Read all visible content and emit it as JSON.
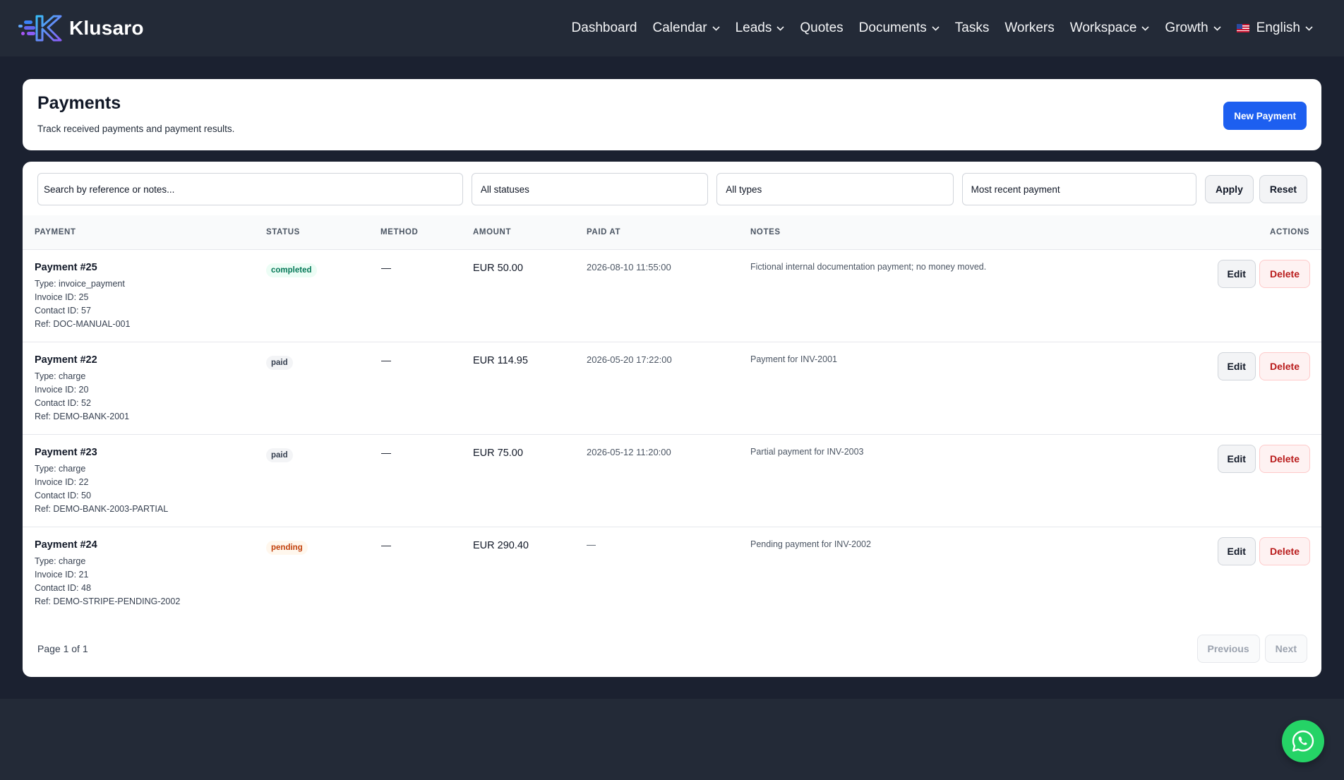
{
  "brand": {
    "name": "Klusaro"
  },
  "nav": {
    "items": [
      {
        "label": "Dashboard",
        "dropdown": false
      },
      {
        "label": "Calendar",
        "dropdown": true
      },
      {
        "label": "Leads",
        "dropdown": true
      },
      {
        "label": "Quotes",
        "dropdown": false
      },
      {
        "label": "Documents",
        "dropdown": true
      },
      {
        "label": "Tasks",
        "dropdown": false
      },
      {
        "label": "Workers",
        "dropdown": false
      },
      {
        "label": "Workspace",
        "dropdown": true
      },
      {
        "label": "Growth",
        "dropdown": true
      }
    ],
    "language": "English"
  },
  "header": {
    "title": "Payments",
    "subtitle": "Track received payments and payment results.",
    "new_button": "New Payment"
  },
  "filters": {
    "search_placeholder": "Search by reference or notes...",
    "status": "All statuses",
    "type": "All types",
    "sort": "Most recent payment",
    "apply": "Apply",
    "reset": "Reset"
  },
  "table": {
    "headers": {
      "payment": "PAYMENT",
      "status": "STATUS",
      "method": "METHOD",
      "amount": "AMOUNT",
      "paid_at": "PAID AT",
      "notes": "NOTES",
      "actions": "ACTIONS"
    },
    "rows": [
      {
        "title": "Payment #25",
        "type": "Type: invoice_payment",
        "invoice": "Invoice ID: 25",
        "contact": "Contact ID: 57",
        "ref": "Ref: DOC-MANUAL-001",
        "status": "completed",
        "method": "—",
        "amount": "EUR 50.00",
        "paid_at": "2026-08-10 11:55:00",
        "notes": "Fictional internal documentation payment; no money moved.",
        "edit": "Edit",
        "delete": "Delete"
      },
      {
        "title": "Payment #22",
        "type": "Type: charge",
        "invoice": "Invoice ID: 20",
        "contact": "Contact ID: 52",
        "ref": "Ref: DEMO-BANK-2001",
        "status": "paid",
        "method": "—",
        "amount": "EUR 114.95",
        "paid_at": "2026-05-20 17:22:00",
        "notes": "Payment for INV-2001",
        "edit": "Edit",
        "delete": "Delete"
      },
      {
        "title": "Payment #23",
        "type": "Type: charge",
        "invoice": "Invoice ID: 22",
        "contact": "Contact ID: 50",
        "ref": "Ref: DEMO-BANK-2003-PARTIAL",
        "status": "paid",
        "method": "—",
        "amount": "EUR 75.00",
        "paid_at": "2026-05-12 11:20:00",
        "notes": "Partial payment for INV-2003",
        "edit": "Edit",
        "delete": "Delete"
      },
      {
        "title": "Payment #24",
        "type": "Type: charge",
        "invoice": "Invoice ID: 21",
        "contact": "Contact ID: 48",
        "ref": "Ref: DEMO-STRIPE-PENDING-2002",
        "status": "pending",
        "method": "—",
        "amount": "EUR 290.40",
        "paid_at": "—",
        "notes": "Pending payment for INV-2002",
        "edit": "Edit",
        "delete": "Delete"
      }
    ]
  },
  "pagination": {
    "info": "Page 1 of 1",
    "previous": "Previous",
    "next": "Next"
  },
  "icons": {
    "chat": "whatsapp-icon",
    "chevron": "chevron-down-icon",
    "flag": "us-flag-icon"
  },
  "colors": {
    "primary": "#1d5ff0",
    "danger": "#b91c1c",
    "success": "#047857",
    "warning": "#c2410c",
    "whatsapp": "#25d366"
  }
}
